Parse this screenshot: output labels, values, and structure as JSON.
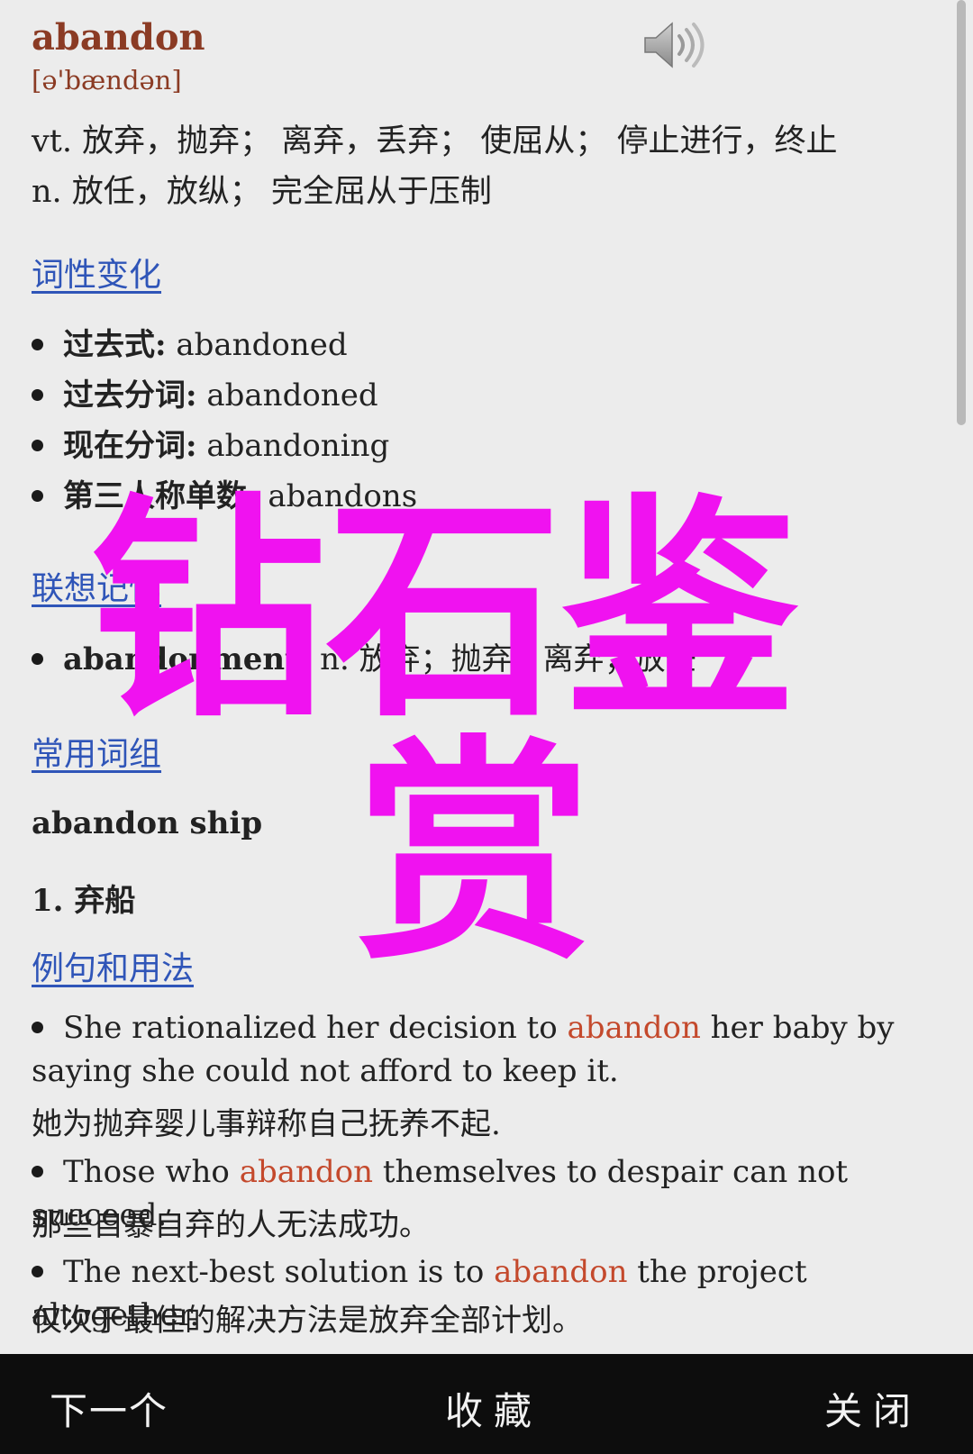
{
  "entry": {
    "word": "abandon",
    "phonetic": "[ə'bændən]",
    "definitions": [
      "vt. 放弃，抛弃； 离弃，丢弃； 使屈从； 停止进行，终止",
      "n. 放任，放纵； 完全屈从于压制"
    ]
  },
  "sections": {
    "forms_title": "词性变化",
    "forms": [
      {
        "label": "过去式:",
        "value": " abandoned"
      },
      {
        "label": "过去分词:",
        "value": " abandoned"
      },
      {
        "label": "现在分词:",
        "value": " abandoning"
      },
      {
        "label": "第三人称单数:",
        "value": " abandons"
      }
    ],
    "assoc_title": "联想记忆",
    "assoc": [
      {
        "label": "abandonment:",
        "value": " n. 放弃；抛弃；离弃；放任"
      }
    ],
    "phrases_title": "常用词组",
    "phrase": "abandon ship",
    "phrase_meaning": "1. 弃船",
    "examples_title": "例句和用法",
    "examples": [
      {
        "before": "She rationalized her decision to ",
        "keyword": "abandon",
        "after": " her baby by saying she could not afford to keep it.",
        "translation": "她为抛弃婴儿事辩称自己抚养不起."
      },
      {
        "before": "Those who ",
        "keyword": "abandon",
        "after": " themselves to despair can not succeed.",
        "translation": "那些自暴自弃的人无法成功。"
      },
      {
        "before": "The next-best solution is to ",
        "keyword": "abandon",
        "after": " the project altogether.",
        "translation": "仅次于最佳的解决方法是放弃全部计划。"
      }
    ]
  },
  "watermark": {
    "line1": "钻石鉴",
    "line2": "赏",
    "color": "#f012f0"
  },
  "bottom_bar": {
    "next": "下一个",
    "favorite": "收藏",
    "close": "关闭"
  },
  "icons": {
    "speaker": "speaker-icon"
  }
}
